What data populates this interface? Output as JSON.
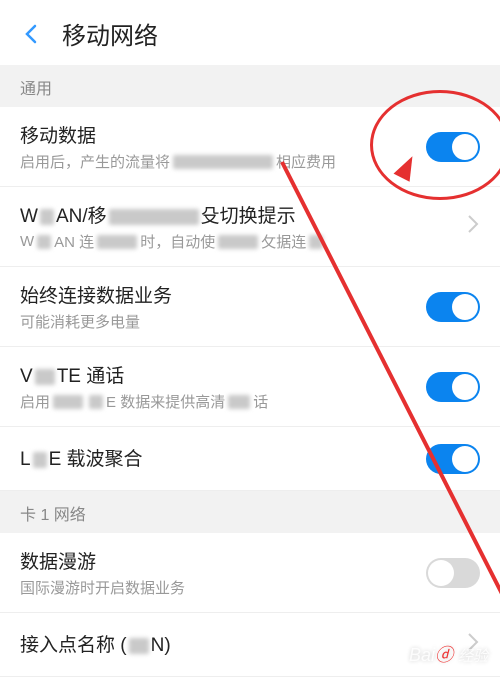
{
  "header": {
    "title": "移动网络"
  },
  "sections": {
    "general": {
      "header": "通用",
      "mobile_data": {
        "title": "移动数据",
        "sub_prefix": "启用后，产生的流量将",
        "sub_suffix": "相应费用",
        "on": true
      },
      "wlan_switch": {
        "title_prefix": "W",
        "title_mid": "AN/移",
        "title_suffix": "殳切换提示",
        "sub_prefix": "W",
        "sub_mid1": "AN 连",
        "sub_mid2": "时，自动使",
        "sub_suffix": "攵据连"
      },
      "always_connect": {
        "title": "始终连接数据业务",
        "sub": "可能消耗更多电量",
        "on": true
      },
      "volte": {
        "title_prefix": "V",
        "title_suffix": "TE 通话",
        "sub_prefix": "启用",
        "sub_mid": "E 数据来提供高清",
        "sub_suffix": "话",
        "on": true
      },
      "carrier_agg": {
        "title_prefix": "L",
        "title_suffix": "E 载波聚合",
        "on": true
      }
    },
    "sim1": {
      "header": "卡 1 网络",
      "roaming": {
        "title": "数据漫游",
        "sub": "国际漫游时开启数据业务",
        "on": false
      },
      "apn": {
        "title_prefix": "接入点名称 (",
        "title_suffix": "N)"
      }
    }
  },
  "watermark": {
    "main": "Bai",
    "sub": "经验"
  }
}
